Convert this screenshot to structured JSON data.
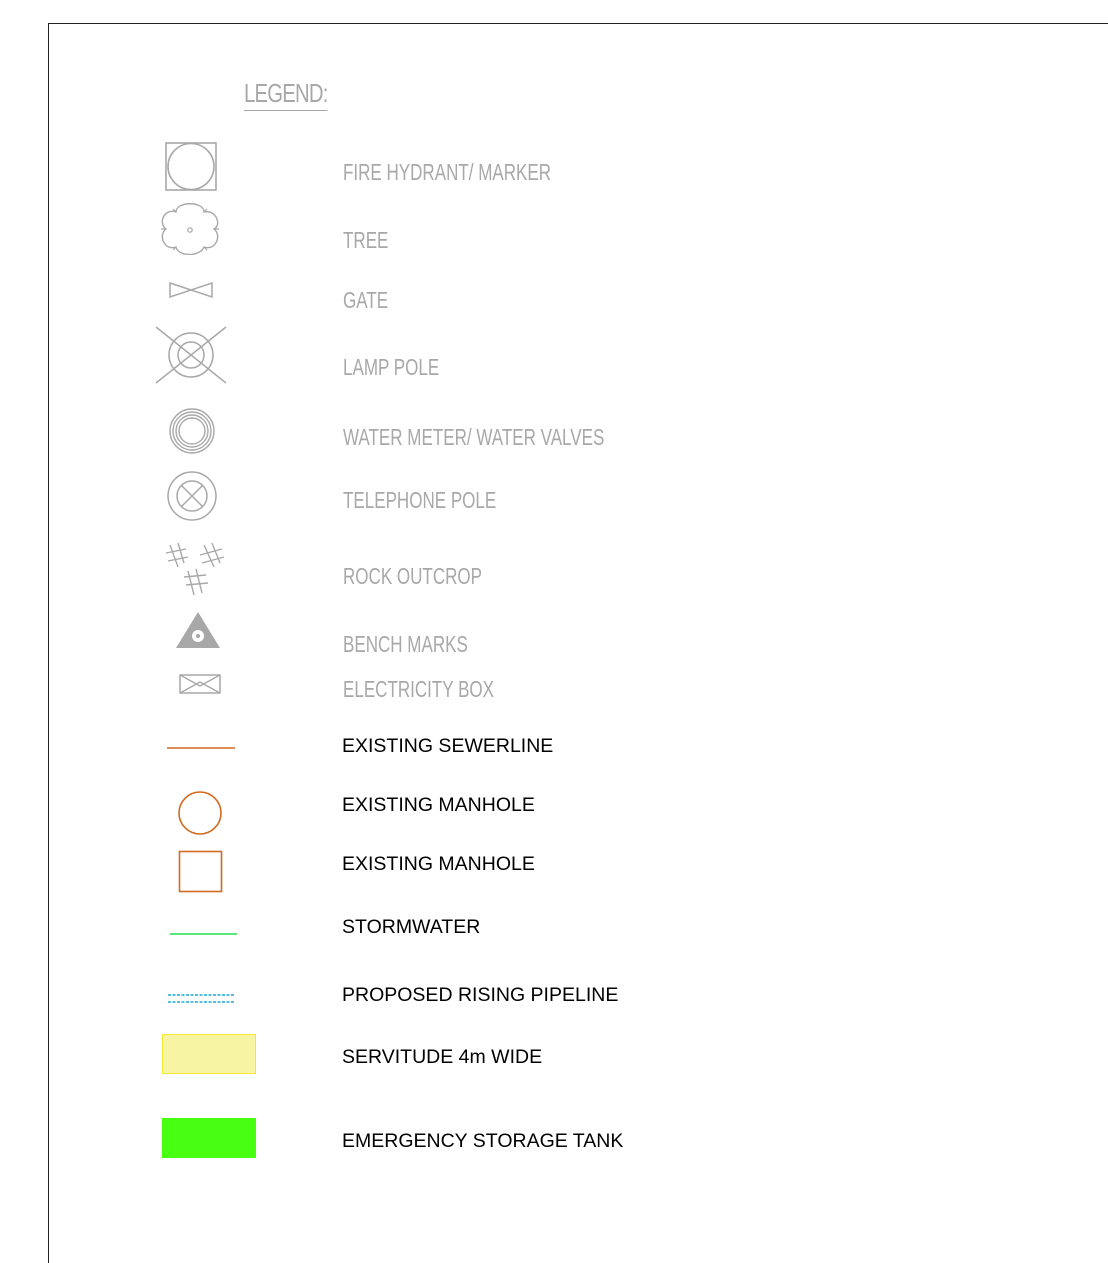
{
  "legend": {
    "title": "LEGEND:",
    "items": [
      {
        "label": "FIRE HYDRANT/ MARKER",
        "icon": "fire-hydrant-marker-icon"
      },
      {
        "label": "TREE",
        "icon": "tree-icon"
      },
      {
        "label": "GATE",
        "icon": "gate-icon"
      },
      {
        "label": "LAMP POLE",
        "icon": "lamp-pole-icon"
      },
      {
        "label": "WATER METER/ WATER VALVES",
        "icon": "water-meter-icon"
      },
      {
        "label": "TELEPHONE POLE",
        "icon": "telephone-pole-icon"
      },
      {
        "label": "ROCK OUTCROP",
        "icon": "rock-outcrop-icon"
      },
      {
        "label": "BENCH MARKS",
        "icon": "bench-mark-icon"
      },
      {
        "label": "ELECTRICITY BOX",
        "icon": "electricity-box-icon"
      },
      {
        "label": "EXISTING SEWERLINE",
        "icon": "sewerline-icon",
        "color": "#d2691e"
      },
      {
        "label": "EXISTING MANHOLE",
        "icon": "manhole-circle-icon",
        "color": "#d2691e"
      },
      {
        "label": "EXISTING MANHOLE",
        "icon": "manhole-square-icon",
        "color": "#d2691e"
      },
      {
        "label": "STORMWATER",
        "icon": "stormwater-line-icon",
        "color": "#22e04a"
      },
      {
        "label": "PROPOSED RISING PIPELINE",
        "icon": "rising-pipeline-icon",
        "color": "#1aa9d6"
      },
      {
        "label": "SERVITUDE 4m WIDE",
        "icon": "servitude-area-icon",
        "color": "#f7f5a4"
      },
      {
        "label": "EMERGENCY STORAGE TANK",
        "icon": "storage-tank-icon",
        "color": "#48ff12"
      }
    ]
  }
}
